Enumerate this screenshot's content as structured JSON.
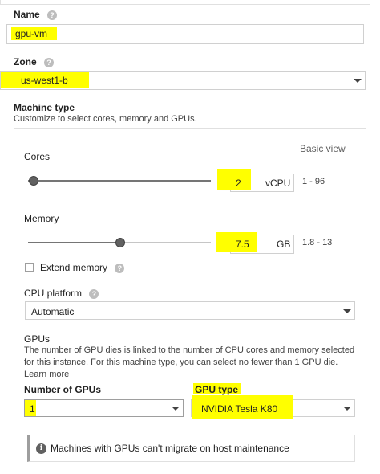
{
  "name": {
    "label": "Name",
    "value": "gpu-vm"
  },
  "zone": {
    "label": "Zone",
    "value": "us-west1-b"
  },
  "machine_type": {
    "label": "Machine type",
    "description": "Customize to select cores, memory and GPUs.",
    "basic_view_link": "Basic view",
    "cores": {
      "label": "Cores",
      "value": "2",
      "unit": "vCPU",
      "range": "1 - 96",
      "slider_fraction": 0.0
    },
    "memory": {
      "label": "Memory",
      "value": "7.5",
      "unit": "GB",
      "range": "1.8 - 13",
      "slider_fraction": 0.51
    },
    "extend_memory": {
      "label": "Extend memory",
      "checked": false
    },
    "cpu_platform": {
      "label": "CPU platform",
      "value": "Automatic"
    },
    "gpus": {
      "label": "GPUs",
      "description_line1": "The number of GPU dies is linked to the number of CPU cores and memory selected",
      "description_line2": "for this instance. For this machine type, you can select no fewer than 1 GPU die.",
      "learn_more": "Learn more",
      "number_label": "Number of GPUs",
      "number_value": "1",
      "type_label": "GPU type",
      "type_value": "NVIDIA Tesla K80"
    },
    "notice": "Machines with GPUs can't migrate on host maintenance"
  },
  "colors": {
    "highlight": "#ffff00",
    "text": "#212121",
    "border": "#d0d0d0"
  }
}
